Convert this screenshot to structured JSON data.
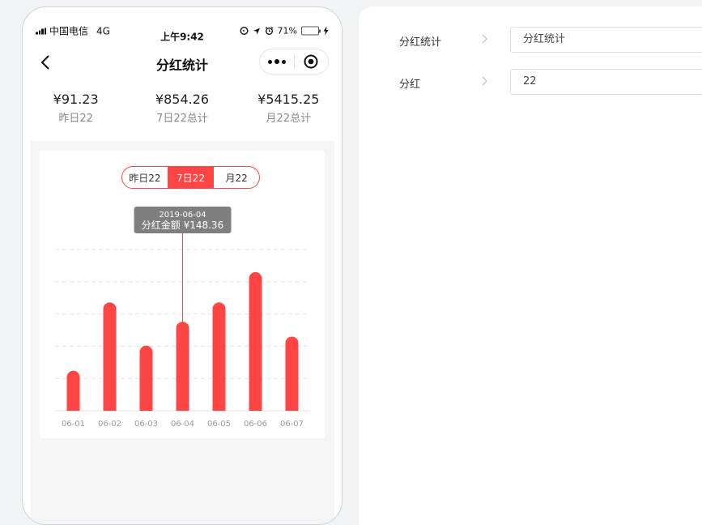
{
  "status_bar": {
    "carrier": "中国电信",
    "network": "4G",
    "time": "上午9:42",
    "battery": "71%",
    "battery_level": 0.71
  },
  "nav": {
    "title": "分红统计"
  },
  "stats": [
    {
      "value": "¥91.23",
      "label": "昨日22"
    },
    {
      "value": "¥854.26",
      "label": "7日22总计"
    },
    {
      "value": "¥5415.25",
      "label": "月22总计"
    }
  ],
  "tabs": [
    {
      "label": "昨日22",
      "active": false
    },
    {
      "label": "7日22",
      "active": true
    },
    {
      "label": "月22",
      "active": false
    }
  ],
  "tooltip": {
    "date": "2019-06-04",
    "text": "分红金额 ¥148.36"
  },
  "chart_data": {
    "type": "bar",
    "categories": [
      "06-01",
      "06-02",
      "06-03",
      "06-04",
      "06-05",
      "06-06",
      "06-07"
    ],
    "values": [
      62,
      168,
      101,
      138,
      168,
      215,
      115
    ],
    "ylim": [
      0,
      250
    ],
    "grid": true,
    "bar_color": "#ff4444",
    "highlight_index": 3
  },
  "settings": [
    {
      "label": "分红统计",
      "value": "分红统计"
    },
    {
      "label": "分红",
      "value": "22"
    }
  ]
}
